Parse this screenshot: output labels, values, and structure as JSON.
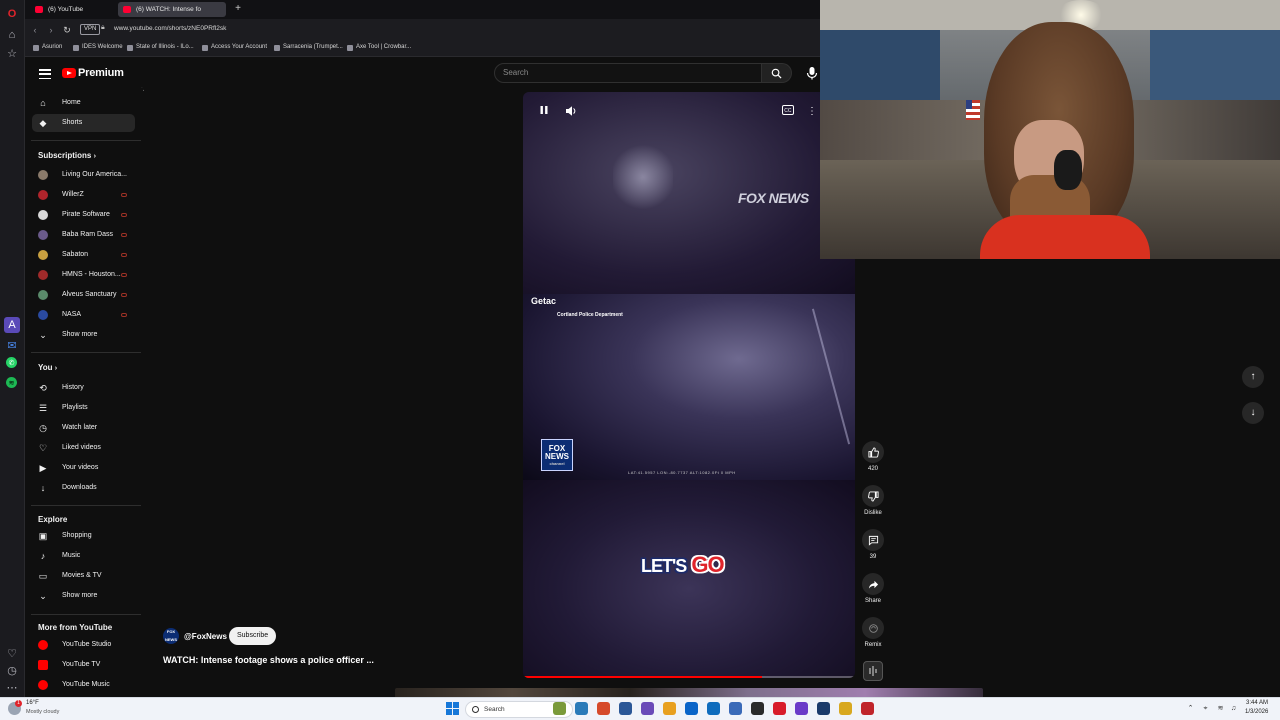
{
  "browser": {
    "tabs": [
      {
        "label": "(6) YouTube"
      },
      {
        "label": "(6) WATCH: Intense fo"
      }
    ],
    "url": "www.youtube.com/shorts/zNE0PRfl2sk",
    "vpn_label": "VPN",
    "bookmarks": [
      "Asurion",
      "IDES Welcome",
      "State of Illinois - ILo...",
      "Access Your Account",
      "Sarracenia (Trumpet...",
      "Axe Tool | Crowbar..."
    ]
  },
  "masthead": {
    "brand": "Premium",
    "search_placeholder": "Search"
  },
  "sidebar": {
    "primary": [
      {
        "label": "Home",
        "icon": "home-icon"
      },
      {
        "label": "Shorts",
        "icon": "shorts-icon"
      }
    ],
    "subscriptions_title": "Subscriptions",
    "subscriptions": [
      {
        "label": "Living Our America...",
        "color": "#8a7a6a"
      },
      {
        "label": "WillerZ",
        "color": "#b0242b"
      },
      {
        "label": "Pirate Software",
        "color": "#d8d8d8"
      },
      {
        "label": "Baba Ram Dass",
        "color": "#6a5a8a"
      },
      {
        "label": "Sabaton",
        "color": "#c8a040"
      },
      {
        "label": "HMNS - Houston...",
        "color": "#a02a2a"
      },
      {
        "label": "Alveus Sanctuary",
        "color": "#5a8a6a"
      },
      {
        "label": "NASA",
        "color": "#2a4aa0"
      }
    ],
    "show_more": "Show more",
    "you_title": "You",
    "you_items": [
      {
        "label": "History",
        "icon": "history-icon",
        "glyph": "⟲"
      },
      {
        "label": "Playlists",
        "icon": "playlists-icon",
        "glyph": "☰"
      },
      {
        "label": "Watch later",
        "icon": "clock-icon",
        "glyph": "◷"
      },
      {
        "label": "Liked videos",
        "icon": "thumbs-up-icon",
        "glyph": "♡"
      },
      {
        "label": "Your videos",
        "icon": "video-icon",
        "glyph": "▶"
      },
      {
        "label": "Downloads",
        "icon": "download-icon",
        "glyph": "↓"
      }
    ],
    "explore_title": "Explore",
    "explore_items": [
      {
        "label": "Shopping",
        "icon": "shopping-icon",
        "glyph": "▣"
      },
      {
        "label": "Music",
        "icon": "music-icon",
        "glyph": "♪"
      },
      {
        "label": "Movies & TV",
        "icon": "movies-icon",
        "glyph": "▭"
      }
    ],
    "explore_show_more": "Show more",
    "more_title": "More from YouTube",
    "more_items": [
      {
        "label": "YouTube Studio",
        "color": "#ff0000"
      },
      {
        "label": "YouTube TV",
        "color": "#ff0000"
      },
      {
        "label": "YouTube Music",
        "color": "#ff0000"
      }
    ]
  },
  "short": {
    "watermark": "FOX NEWS",
    "cam_brand": "Getac",
    "cam_department": "Cortland Police Department",
    "cam_meta": "LAT:41.5957  LON:-80.7737  ALT:1082.0Ft  0 MPH",
    "caption_first": "LET'S",
    "caption_second": "GO",
    "fox_badge_line1": "FOX",
    "fox_badge_line2": "NEWS",
    "fox_badge_line3": "channel",
    "progress": 0.72
  },
  "channel": {
    "handle": "@FoxNews",
    "subscribe_label": "Subscribe",
    "avatar_text": "FOX NEWS",
    "title": "WATCH: Intense footage shows a police officer ..."
  },
  "actions": {
    "like_count": "420",
    "dislike_label": "Dislike",
    "comment_count": "39",
    "share_label": "Share",
    "remix_label": "Remix"
  },
  "taskbar": {
    "weather_temp": "16°F",
    "weather_desc": "Mostly cloudy",
    "weather_badge": "1",
    "search_label": "Search",
    "time": "3:44 AM",
    "date": "1/3/2026",
    "app_colors": [
      "#7a9a3a",
      "#2a7ab8",
      "#d64a2a",
      "#2b5797",
      "#6a4ab8",
      "#e8a020",
      "#0a64c8",
      "#0f6cbd",
      "#3a6ab8",
      "#2a2a2a",
      "#d81b2a",
      "#6a3ac8",
      "#1a3a6a",
      "#d8a820",
      "#c0242b"
    ]
  }
}
